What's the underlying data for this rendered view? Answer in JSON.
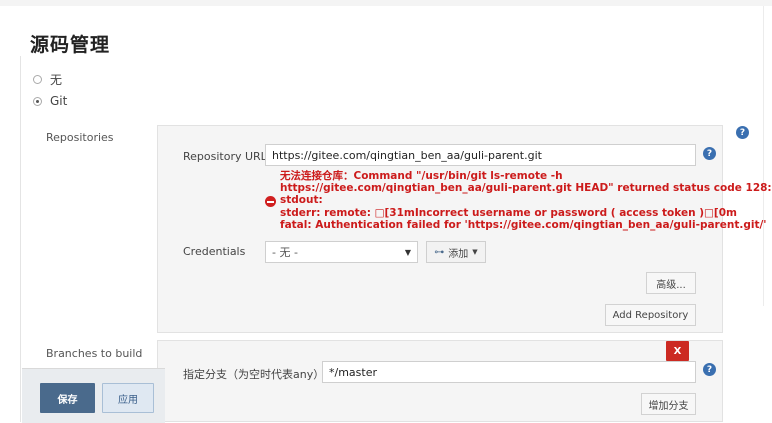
{
  "section": {
    "title": "源码管理"
  },
  "scm_options": [
    {
      "label": "无",
      "selected": false
    },
    {
      "label": "Git",
      "selected": true
    }
  ],
  "repositories": {
    "label": "Repositories",
    "url_label": "Repository URL",
    "url_value": "https://gitee.com/qingtian_ben_aa/guli-parent.git",
    "error_lines": [
      "无法连接仓库：Command \"/usr/bin/git ls-remote -h",
      "https://gitee.com/qingtian_ben_aa/guli-parent.git HEAD\" returned status code 128:",
      "stdout:",
      "stderr: remote: □[31mIncorrect username or password ( access token )□[0m",
      "fatal: Authentication failed for 'https://gitee.com/qingtian_ben_aa/guli-parent.git/'"
    ],
    "credentials_label": "Credentials",
    "credentials_value": "- 无 -",
    "add_button": "添加",
    "advanced_button": "高级...",
    "add_repository_button": "Add Repository"
  },
  "branches": {
    "label": "Branches to build",
    "delete_button": "X",
    "branch_label": "指定分支（为空时代表any）",
    "branch_value": "*/master",
    "add_branch_button": "增加分支"
  },
  "footer": {
    "save_button": "保存",
    "apply_button": "应用"
  },
  "icons": {
    "help": "question-icon",
    "error": "error-icon",
    "add": "key-icon"
  },
  "colors": {
    "error": "#cc1b1b",
    "primary": "#4a6a8c",
    "danger": "#cc2a22",
    "help": "#3a6fb0"
  }
}
